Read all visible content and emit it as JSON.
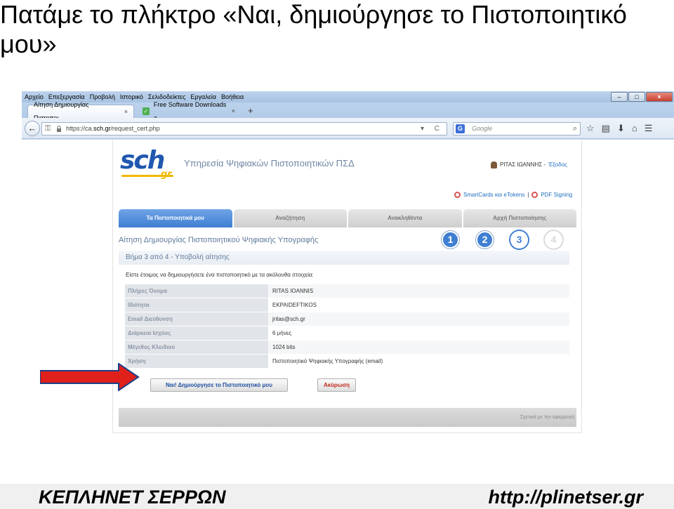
{
  "slide": {
    "title": "Πατάμε το πλήκτρο «Ναι, δημιούργησε το Πιστοποιητικό μου»",
    "footer_left": "ΚΕΠΛΗΝΕΤ ΣΕΡΡΩΝ",
    "footer_right": "http://plinetser.gr"
  },
  "browser": {
    "menu": [
      "Αρχείο",
      "Επεξεργασία",
      "Προβολή",
      "Ιστορικό",
      "Σελιδοδείκτες",
      "Εργαλεία",
      "Βοήθεια"
    ],
    "tabs": [
      {
        "label": "Αίτηση Δημιουργίας Πιστοποι...",
        "close": "×"
      },
      {
        "label": "Free Software Downloads a...",
        "close": "×"
      }
    ],
    "new_tab": "+",
    "url_prefix": "https://ca.",
    "url_host": "sch.gr",
    "url_path": "/request_cert.php",
    "search_engine": "G",
    "search_placeholder": "Google",
    "url_tools": "▾ C",
    "search_icon": "magnifier-icon",
    "toolbar_icons": [
      "star-icon",
      "bookmarks-icon",
      "download-icon",
      "home-icon",
      "menu-icon"
    ]
  },
  "page": {
    "logo_main": "sch",
    "logo_sub": "gr",
    "service_title": "Υπηρεσία Ψηφιακών Πιστοποιητικών ΠΣΔ",
    "user_name": "ΡΙΤΑΣ ΙΩΑΝΝΗΣ -",
    "logout": "Έξοδος",
    "helper_smartcards": "SmartCards και eTokens",
    "helper_sep": "|",
    "helper_pdf": "PDF Signing",
    "nav_tabs": [
      "Τα Πιστοποιητικά μου",
      "Αναζήτηση",
      "Ανακληθέντα",
      "Αρχή Πιστοποίησης"
    ],
    "section_title": "Αίτηση Δημιουργίας Πιστοποιητικού Ψηφιακής Υπογραφής",
    "steps": [
      "1",
      "2",
      "3",
      "4"
    ],
    "step_label": "Βήμα 3 από 4 - Υποβολή αίτησης",
    "intro": "Είστε έτοιμος να δημιουργήσετε ένα πιστοποιητικό με τα ακόλουθα στοιχεία:",
    "details": [
      {
        "label": "Πλήρες Όνομα",
        "value": "RITAS IOANNIS"
      },
      {
        "label": "Ιδιότητα",
        "value": "EKPAIDEFTIKOS"
      },
      {
        "label": "Email Διεύθυνση",
        "value": "jritas@sch.gr"
      },
      {
        "label": "Διάρκεια Ισχύος",
        "value": "6 μήνες"
      },
      {
        "label": "Μέγεθος Κλειδιού",
        "value": "1024 bits"
      },
      {
        "label": "Χρήση",
        "value": "Πιστοποιητικό Ψηφιακής Υπογραφής (email)"
      }
    ],
    "create_button": "Ναι! Δημιούργησε το Πιστοποιητικό μου",
    "cancel_button": "Ακύρωση",
    "about": "Σχετικά με την εφαρμογή",
    "colors": {
      "accent": "#3f7fd2",
      "arrow": "#e0201b",
      "cancel": "#c02b1b"
    }
  }
}
